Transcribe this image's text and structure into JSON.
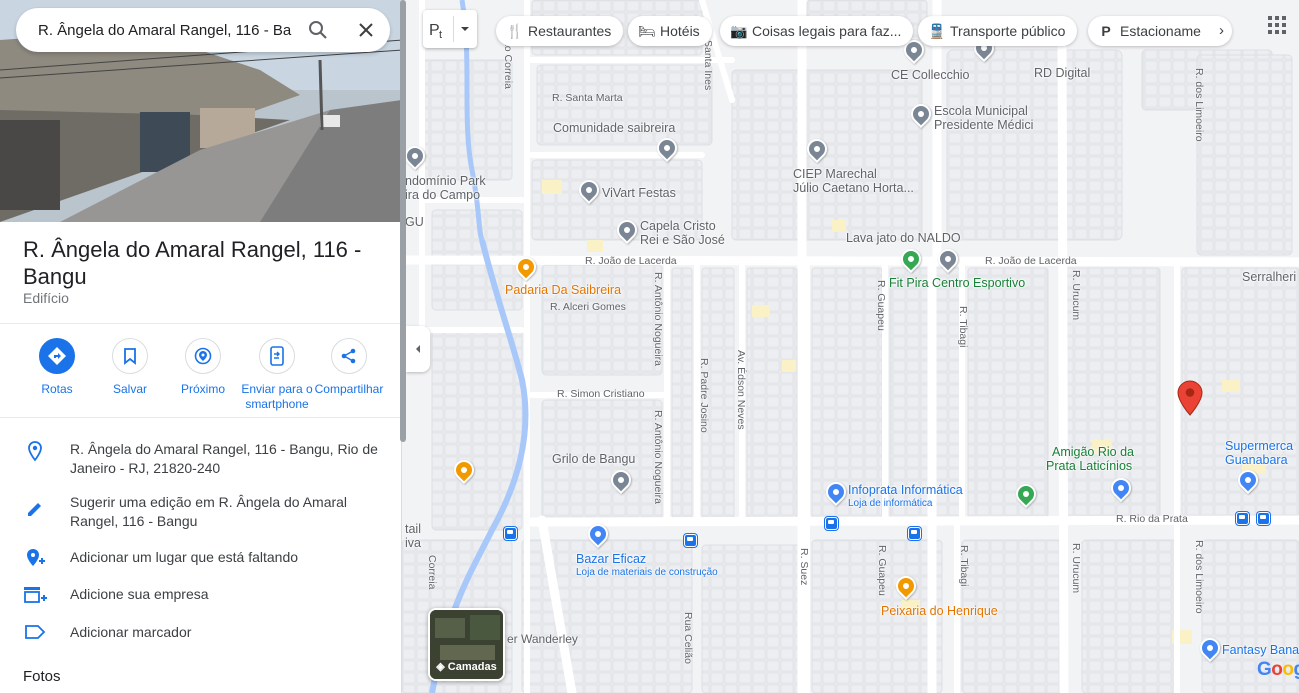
{
  "search": {
    "query": "R. Ângela do Amaral Rangel, 116 - Ba"
  },
  "place": {
    "title": "R. Ângela do Amaral Rangel, 116 - Bangu",
    "category": "Edifício"
  },
  "actions": [
    {
      "label": "Rotas",
      "icon": "directions-icon"
    },
    {
      "label": "Salvar",
      "icon": "bookmark-icon"
    },
    {
      "label": "Próximo",
      "icon": "nearby-icon"
    },
    {
      "label": "Enviar para o smartphone",
      "icon": "send-to-phone-icon"
    },
    {
      "label": "Compartilhar",
      "icon": "share-icon"
    }
  ],
  "info": {
    "address": "R. Ângela do Amaral Rangel, 116 - Bangu, Rio de Janeiro - RJ, 21820-240",
    "suggest_edit": "Sugerir uma edição em R. Ângela do Amaral Rangel, 116 - Bangu",
    "add_place": "Adicionar um lugar que está faltando",
    "add_business": "Adicione sua empresa",
    "add_label": "Adicionar marcador"
  },
  "photos_heading": "Fotos",
  "chips": [
    "Restaurantes",
    "Hotéis",
    "Coisas legais para faz...",
    "Transporte público",
    "Estacioname"
  ],
  "layers_label": "Camadas",
  "google_logo": "Google",
  "map": {
    "pois": {
      "collecchio": "CE Collecchio",
      "rd": "RD Digital",
      "escola": "Escola Municipal",
      "escola2": "Presidente Médici",
      "comunidade": "Comunidade saibreira",
      "ciep": "CIEP Marechal",
      "ciep2": "Júlio Caetano Horta...",
      "condominio": "ndomínio Park",
      "condominio2": "ira do Campo",
      "vivart": "ViVart Festas",
      "capela": "Capela Cristo",
      "capela2": "Rei e São José",
      "lavajato": "Lava jato do NALDO",
      "padaria": "Padaria Da Saibreira",
      "fitpira": "Fit Pira Centro Esportivo",
      "serralheria": "Serralheri",
      "grilo": "Grilo de Bangu",
      "amigao": "Amigão Rio da",
      "amigao2": "Prata Laticínios",
      "supermercado": "Supermerca",
      "supermercado2": "Guanabara",
      "infoprata": "Infoprata Informática",
      "infoprata_sub": "Loja de informática",
      "bazar": "Bazar Eficaz",
      "bazar_sub": "Loja de materiais de construção",
      "peixaria": "Peixaria do Henrique",
      "fantasy": "Fantasy Bana",
      "retail": "tail",
      "retail2": "iva",
      "gu": "GU"
    },
    "streets": {
      "santa_marta": "R. Santa Marta",
      "joao_lacerda_w": "R. João de Lacerda",
      "joao_lacerda_e": "R. João de Lacerda",
      "alceri": "R. Alceri Gomes",
      "simon": "R. Simon Cristiano",
      "rio_prata": "R. Rio da Prata",
      "wanderley": "er Wanderley",
      "antonio_nogueira_1": "R. Antônio Nogueira",
      "antonio_nogueira_2": "R. Antônio Nogueira",
      "padre_josino": "R. Padre Josino",
      "edson_neves": "Av. Édson Neves",
      "guapeu_n": "R. Guapeu",
      "guapeu_s": "R. Guapeu",
      "tibagi_n": "R. Tibagi",
      "tibagi_s": "R. Tibagi",
      "urucum_n": "R. Urucum",
      "urucum_s": "R. Urucum",
      "limoeiro_n": "R. dos Limoeiro",
      "limoeiro_s": "R. dos Limoeiro",
      "suez": "R. Suez",
      "celiao": "Rua Celião",
      "correia": "Pato Correia",
      "correia_s": "Correia",
      "santa_ines": "Santa Ines"
    }
  },
  "colors": {
    "accent": "#1a73e8",
    "marker_red": "#ea4335",
    "poi_orange": "#e37400",
    "poi_green": "#188038",
    "river": "#a8c8fa"
  }
}
